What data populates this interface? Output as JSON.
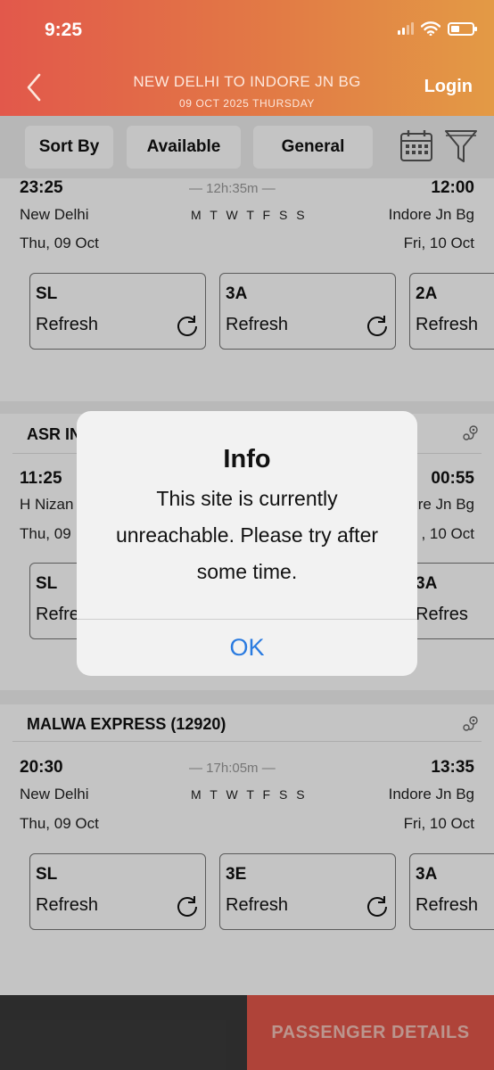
{
  "status_bar": {
    "time": "9:25"
  },
  "header": {
    "route": "NEW DELHI TO INDORE JN BG",
    "date": "09 OCT 2025 THURSDAY",
    "login": "Login"
  },
  "filters": {
    "sort": "Sort By",
    "available": "Available",
    "general": "General"
  },
  "trains": [
    {
      "name": "",
      "dep_time": "23:25",
      "dep_station": "New Delhi",
      "dep_date": "Thu, 09 Oct",
      "duration": "— 12h:35m —",
      "days": "M T W T F S S",
      "arr_time": "12:00",
      "arr_station": "Indore Jn Bg",
      "arr_date": "Fri, 10 Oct",
      "classes": [
        {
          "cls": "SL",
          "status": "Refresh"
        },
        {
          "cls": "3A",
          "status": "Refresh"
        },
        {
          "cls": "2A",
          "status": "Refresh"
        }
      ]
    },
    {
      "name": "ASR IN",
      "dep_time": "11:25",
      "dep_station": "H Nizan",
      "dep_date": "Thu, 09",
      "arr_time": "00:55",
      "arr_station": "re Jn Bg",
      "arr_date": ", 10 Oct",
      "classes": [
        {
          "cls": "SL",
          "status": "Refre"
        },
        {
          "cls": "3A",
          "status": "Refres"
        }
      ]
    },
    {
      "name": "MALWA EXPRESS (12920)",
      "dep_time": "20:30",
      "dep_station": "New Delhi",
      "dep_date": "Thu, 09 Oct",
      "duration": "— 17h:05m —",
      "days": "M T W T F S S",
      "arr_time": "13:35",
      "arr_station": "Indore Jn Bg",
      "arr_date": "Fri, 10 Oct",
      "classes": [
        {
          "cls": "SL",
          "status": "Refresh"
        },
        {
          "cls": "3E",
          "status": "Refresh"
        },
        {
          "cls": "3A",
          "status": "Refresh"
        }
      ]
    }
  ],
  "footer": {
    "passenger_details": "PASSENGER DETAILS"
  },
  "dialog": {
    "title": "Info",
    "message": "This site is currently unreachable. Please try after some time.",
    "ok": "OK"
  },
  "colors": {
    "header_start": "#e2584b",
    "header_end": "#e39a45",
    "accent": "#e4584b",
    "link": "#2a7be0"
  }
}
